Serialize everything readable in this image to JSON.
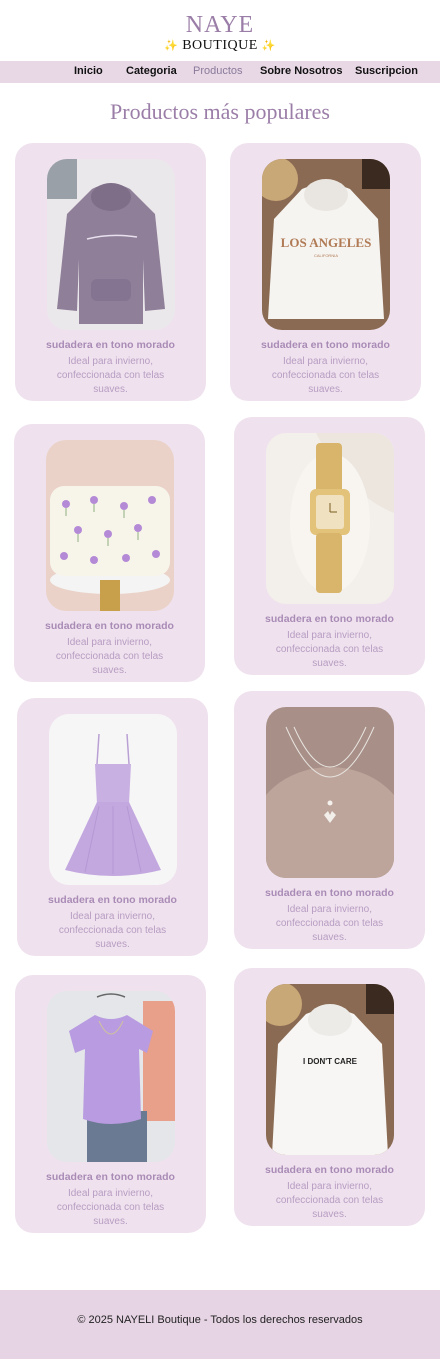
{
  "brand": {
    "name": "NAYE",
    "subtitle": "BOUTIQUE",
    "spark": "✨"
  },
  "nav": [
    {
      "label": "Inicio"
    },
    {
      "label": "Categoria"
    },
    {
      "label": "Productos",
      "active": true
    },
    {
      "label": "Sobre Nosotros"
    },
    {
      "label": "Suscripcion"
    }
  ],
  "section": {
    "title": "Productos más populares"
  },
  "products": [
    {
      "image": "purple-hoodie-photo",
      "title": "sudadera en tono morado",
      "description": "Ideal para invierno, confeccionada con telas suaves."
    },
    {
      "image": "white-los-angeles-hoodie-photo",
      "image_text": "LOS ANGELES",
      "image_subtext": "CALIFORNIA",
      "title": "sudadera en tono morado",
      "description": "Ideal para invierno, confeccionada con telas suaves."
    },
    {
      "image": "floral-pouch-photo",
      "title": "sudadera en tono morado",
      "description": "Ideal para invierno, confeccionada con telas suaves."
    },
    {
      "image": "gold-watch-photo",
      "title": "sudadera en tono morado",
      "description": "Ideal para invierno, confeccionada con telas suaves."
    },
    {
      "image": "lilac-dress-photo",
      "title": "sudadera en tono morado",
      "description": "Ideal para invierno, confeccionada con telas suaves."
    },
    {
      "image": "butterfly-necklace-photo",
      "title": "sudadera en tono morado",
      "description": "Ideal para invierno, confeccionada con telas suaves."
    },
    {
      "image": "lilac-tshirt-photo",
      "title": "sudadera en tono morado",
      "description": "Ideal para invierno, confeccionada con telas suaves."
    },
    {
      "image": "white-i-dont-care-hoodie-photo",
      "image_text": "I DON'T CARE",
      "title": "sudadera en tono morado",
      "description": "Ideal para invierno, confeccionada con telas suaves."
    }
  ],
  "footer": {
    "text": "© 2025 NAYELI Boutique - Todos los derechos reservados"
  },
  "colors": {
    "accent": "#9b7ea8",
    "nav_bg": "#e8d8e6",
    "card_bg": "#efe2ee",
    "footer_bg": "#e6d4e4"
  }
}
